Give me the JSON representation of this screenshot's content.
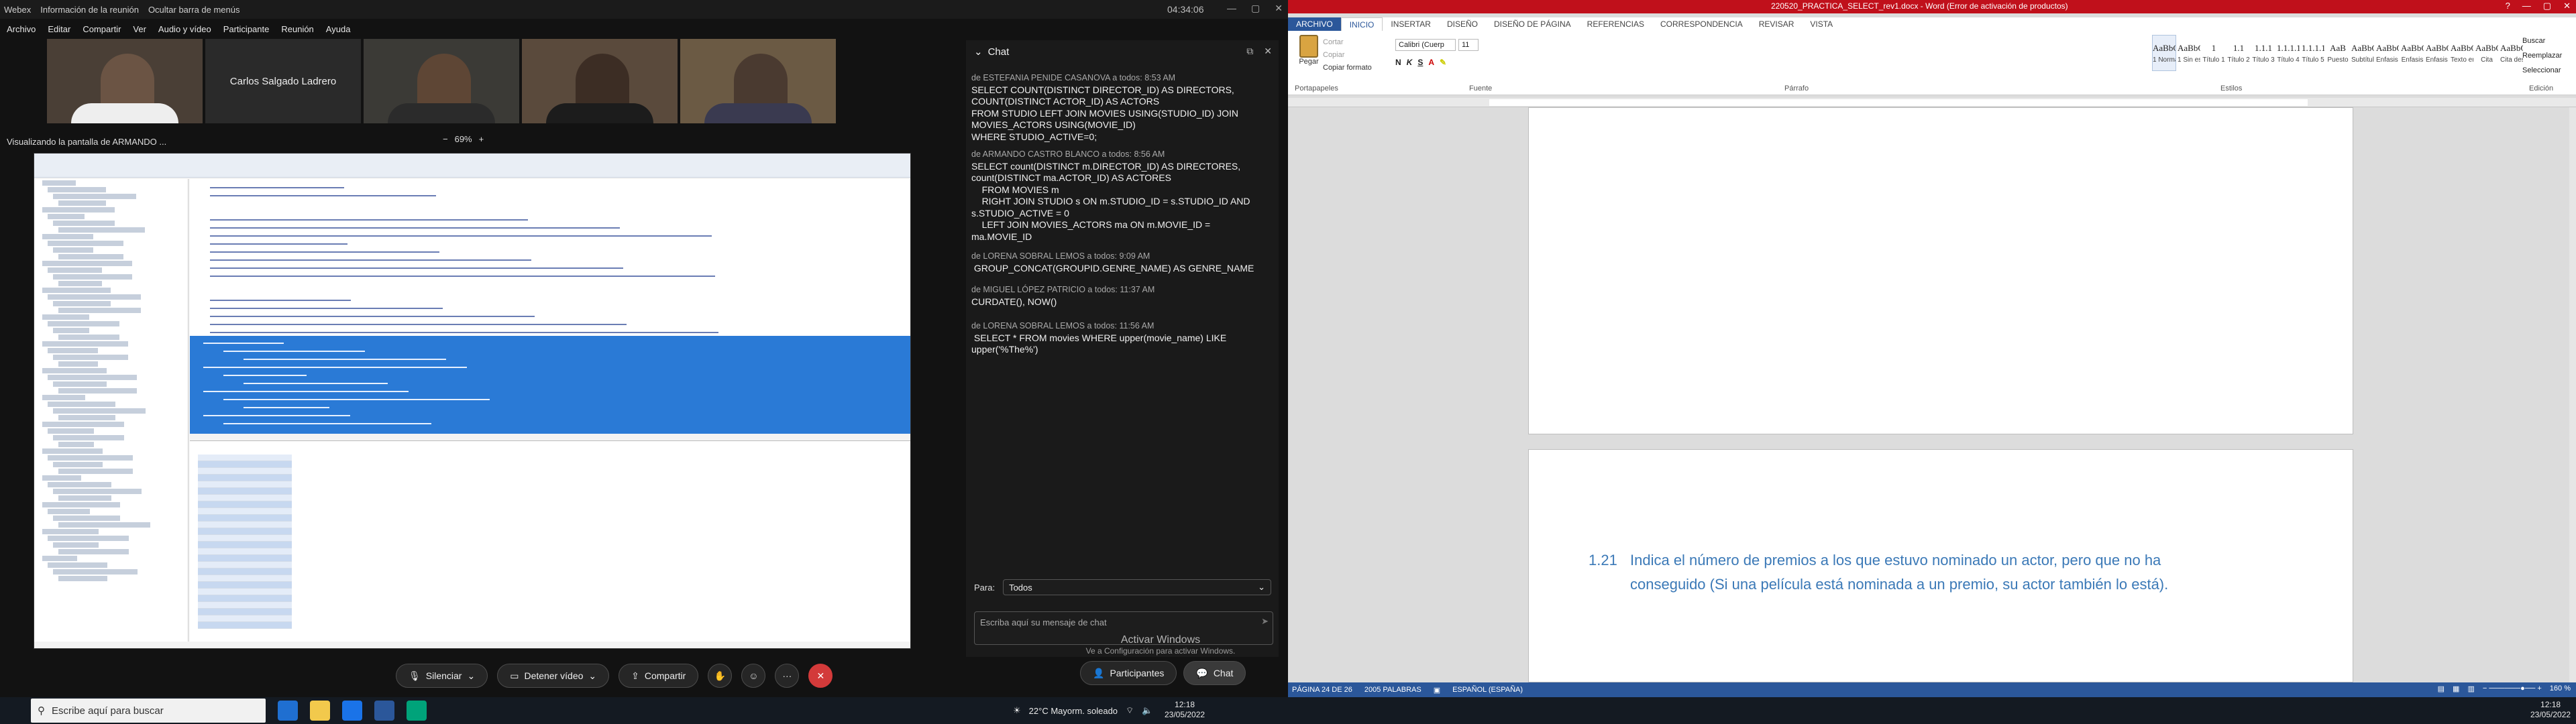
{
  "webex": {
    "title_items": [
      "Webex",
      "Información de la reunión",
      "Ocultar barra de menús"
    ],
    "title_time": "04:34:06",
    "menu": [
      "Archivo",
      "Editar",
      "Compartir",
      "Ver",
      "Audio y vídeo",
      "Participante",
      "Reunión",
      "Ayuda"
    ],
    "participant_name": "Carlos Salgado Ladrero",
    "share_label": "Visualizando la pantalla de ARMANDO ...",
    "zoom": "69%",
    "zoom_minus": "−",
    "zoom_plus": "+"
  },
  "chat": {
    "title": "Chat",
    "messages": [
      {
        "meta": "de ESTEFANIA PENIDE CASANOVA a todos:    8:53 AM",
        "body": "SELECT COUNT(DISTINCT DIRECTOR_ID) AS DIRECTORS,\nCOUNT(DISTINCT ACTOR_ID) AS ACTORS\nFROM STUDIO LEFT JOIN MOVIES USING(STUDIO_ID) JOIN\nMOVIES_ACTORS USING(MOVIE_ID)\nWHERE STUDIO_ACTIVE=0;"
      },
      {
        "meta": "de ARMANDO CASTRO BLANCO a todos:    8:56 AM",
        "body": "SELECT count(DISTINCT m.DIRECTOR_ID) AS DIRECTORES,\ncount(DISTINCT ma.ACTOR_ID) AS ACTORES\n    FROM MOVIES m\n    RIGHT JOIN STUDIO s ON m.STUDIO_ID = s.STUDIO_ID AND\ns.STUDIO_ACTIVE = 0\n    LEFT JOIN MOVIES_ACTORS ma ON m.MOVIE_ID =\nma.MOVIE_ID"
      },
      {
        "meta": "de LORENA SOBRAL LEMOS a todos:    9:09 AM",
        "body": " GROUP_CONCAT(GROUPID.GENRE_NAME) AS GENRE_NAME"
      },
      {
        "meta": "de MIGUEL LÓPEZ PATRICIO a todos:    11:37 AM",
        "body": "CURDATE(), NOW()"
      },
      {
        "meta": "de LORENA SOBRAL LEMOS a todos:    11:56 AM",
        "body": " SELECT * FROM movies WHERE upper(movie_name) LIKE\nupper('%The%')"
      }
    ],
    "to_label": "Para:",
    "to_value": "Todos",
    "input_placeholder": "Escriba aquí su mensaje de chat"
  },
  "windows_activation": {
    "line1": "Activar Windows",
    "line2": "Ve a Configuración para activar Windows."
  },
  "controls": {
    "mute": "Silenciar",
    "stop_video": "Detener vídeo",
    "share": "Compartir",
    "participants": "Participantes",
    "chat": "Chat",
    "more": "···"
  },
  "taskbar": {
    "search_placeholder": "Escribe aquí para buscar",
    "weather": "22°C  Mayorm. soleado",
    "clock_time": "12:18",
    "clock_date": "23/05/2022"
  },
  "word": {
    "title": "220520_PRACTICA_SELECT_rev1.docx - Word (Error de activación de productos)",
    "tabs": [
      "ARCHIVO",
      "INICIO",
      "INSERTAR",
      "DISEÑO",
      "DISEÑO DE PÁGINA",
      "REFERENCIAS",
      "CORRESPONDENCIA",
      "REVISAR",
      "VISTA"
    ],
    "clipboard": {
      "paste": "Pegar",
      "cut": "Cortar",
      "copy": "Copiar",
      "format": "Copiar formato"
    },
    "font_name": "Calibri (Cuerp",
    "font_size": "11",
    "styles": [
      {
        "preview": "AaBbCcDc",
        "name": "1 Normal"
      },
      {
        "preview": "AaBbCcDc",
        "name": "1 Sin espa..."
      },
      {
        "preview": "1 AaBl",
        "name": "Título 1"
      },
      {
        "preview": "1.1 AaBb",
        "name": "Título 2"
      },
      {
        "preview": "1.1.1 Aa",
        "name": "Título 3"
      },
      {
        "preview": "1.1.1.1 A",
        "name": "Título 4"
      },
      {
        "preview": "1.1.1.1.1",
        "name": "Título 5"
      },
      {
        "preview": "AaB",
        "name": "Puesto"
      },
      {
        "preview": "AaBbCcD",
        "name": "Subtítulo"
      },
      {
        "preview": "AaBbCcDc",
        "name": "Énfasis sutil"
      },
      {
        "preview": "AaBbCcDc",
        "name": "Énfasis"
      },
      {
        "preview": "AaBbCcDc",
        "name": "Énfasis int..."
      },
      {
        "preview": "AaBbCcDc",
        "name": "Texto en n..."
      },
      {
        "preview": "AaBbCcDc",
        "name": "Cita"
      },
      {
        "preview": "AaBbCcDc",
        "name": "Cita desta..."
      }
    ],
    "group_labels": [
      "Portapapeles",
      "Fuente",
      "Párrafo",
      "Estilos",
      "Edición"
    ],
    "editing": [
      "Buscar",
      "Reemplazar",
      "Seleccionar"
    ],
    "question_number": "1.21",
    "question_text": "Indica el número de premios a los que estuvo nominado un actor, pero que no ha conseguido (Si una película está nominada a un premio, su actor también lo está).",
    "status": {
      "page": "PÁGINA 24 DE 26",
      "words": "2005 PALABRAS",
      "lang": "ESPAÑOL (ESPAÑA)",
      "zoom": "160 %"
    }
  }
}
